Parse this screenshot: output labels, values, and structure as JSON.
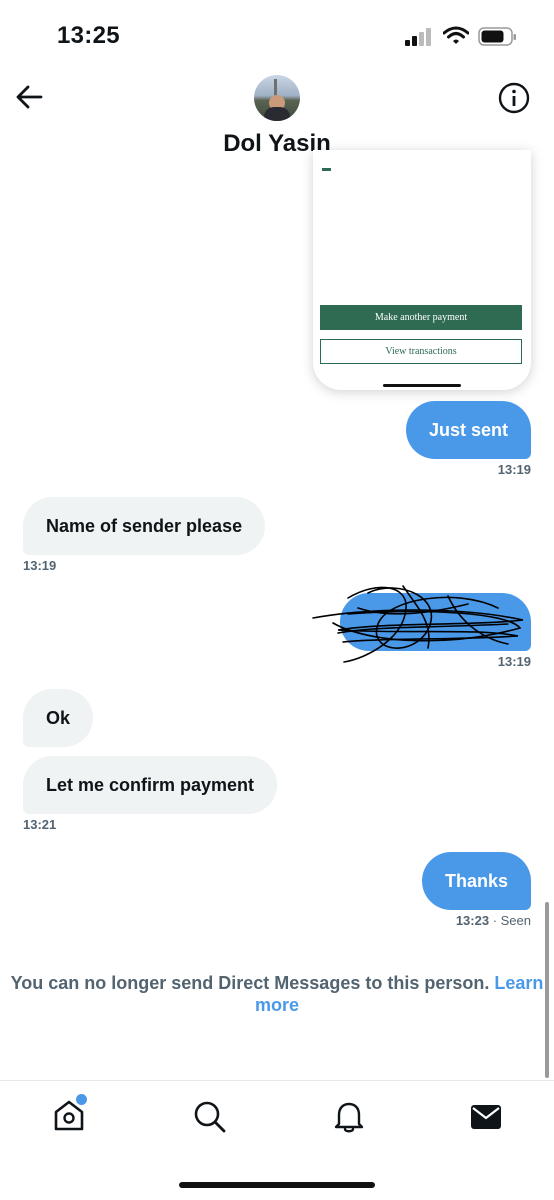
{
  "status_bar": {
    "time": "13:25"
  },
  "header": {
    "contact_name": "Dol Yasin"
  },
  "attachment": {
    "primary_button": "Make another payment",
    "secondary_button": "View transactions"
  },
  "messages": [
    {
      "direction": "out",
      "text": "Just sent",
      "time": "13:19"
    },
    {
      "direction": "in",
      "text": "Name of sender please",
      "time": "13:19"
    },
    {
      "direction": "out",
      "text": "",
      "time": "13:19",
      "note": "scribbled out"
    },
    {
      "direction": "in",
      "text": "Ok"
    },
    {
      "direction": "in",
      "text": "Let me confirm payment",
      "time": "13:21"
    },
    {
      "direction": "out",
      "text": "Thanks",
      "time": "13:23",
      "status": "· Seen"
    }
  ],
  "notice": {
    "text": "You can no longer send Direct Messages to this person.",
    "link": "Learn more"
  },
  "tab_bar": {
    "items": [
      "home-icon",
      "search-icon",
      "notifications-icon",
      "messages-icon"
    ],
    "home_badge": true
  },
  "colors": {
    "accent": "#4a99e9",
    "incoming_bubble": "#eff3f4",
    "bank_green": "#2e6b52"
  }
}
